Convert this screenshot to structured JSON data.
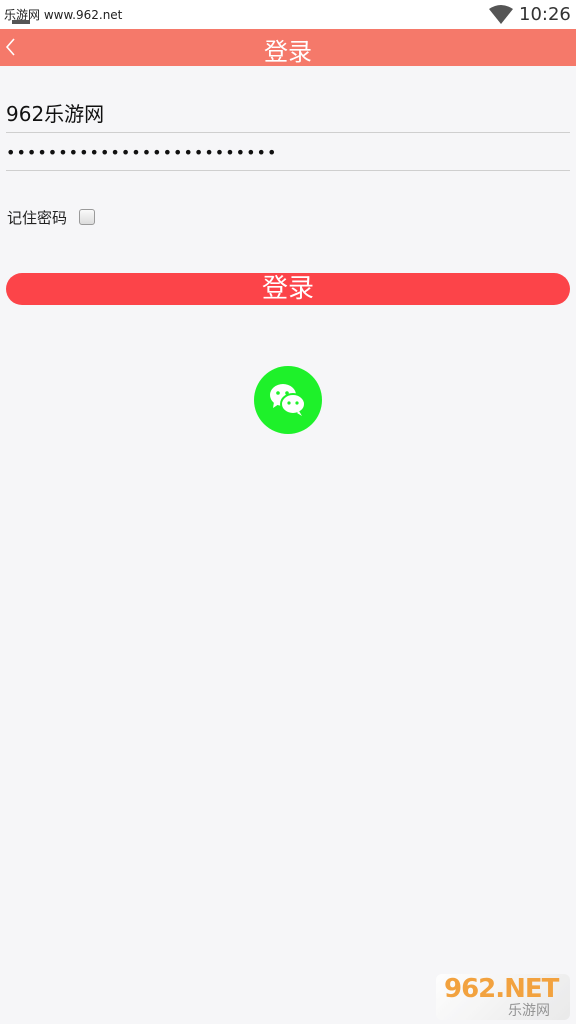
{
  "status_bar": {
    "watermark": "乐游网 www.962.net",
    "time": "10:26",
    "wifi_icon": "wifi-icon"
  },
  "header": {
    "title": "登录",
    "back_icon": "chevron-left-icon",
    "background": "#f5796a"
  },
  "form": {
    "username_value": "962乐游网",
    "password_value": "••••••••••••••••••••••••••",
    "remember_label": "记住密码",
    "remember_checked": false,
    "login_label": "登录",
    "login_color": "#fc4449"
  },
  "social": {
    "wechat_icon": "wechat-icon",
    "wechat_color": "#1ef12a"
  },
  "watermark": {
    "main": "962.NET",
    "sub": "乐游网"
  }
}
